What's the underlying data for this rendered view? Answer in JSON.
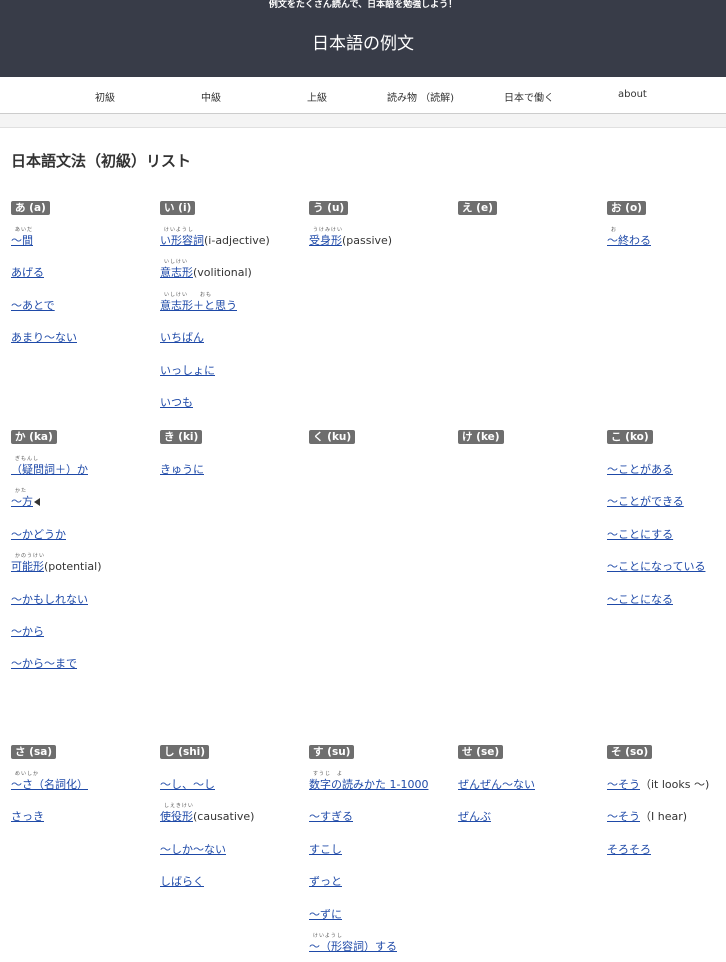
{
  "header": {
    "tagline": "例文をたくさん読んで、日本語を勉強しよう！",
    "site_title": "日本語の例文"
  },
  "nav": [
    "初級",
    "中級",
    "上級",
    "読み物 （読解)",
    "日本で働く",
    "about"
  ],
  "page_title": "日本語文法（初級）リスト",
  "sections": [
    {
      "columns": [
        {
          "badge": "あ (a)",
          "entries": [
            {
              "link": "〜間",
              "ruby": "あいだ"
            },
            {
              "link": "あげる"
            },
            {
              "link": "〜あとで"
            },
            {
              "link": "あまり〜ない"
            }
          ]
        },
        {
          "badge": "い (i)",
          "entries": [
            {
              "link": "い形容詞",
              "suffix": "(i-adjective)",
              "ruby": "けいようし"
            },
            {
              "link": "意志形",
              "suffix": "(volitional)",
              "ruby": "いしけい"
            },
            {
              "link": "意志形＋と思う",
              "ruby": "いしけい　　おも"
            },
            {
              "link": "いちばん"
            },
            {
              "link": "いっしょに"
            },
            {
              "link": "いつも"
            }
          ]
        },
        {
          "badge": "う (u)",
          "entries": [
            {
              "link": "受身形",
              "suffix": "(passive)",
              "ruby": "うけみけい"
            }
          ]
        },
        {
          "badge": "え (e)",
          "entries": []
        },
        {
          "badge": "お (o)",
          "entries": [
            {
              "link": "〜終わる",
              "ruby": "お"
            }
          ]
        }
      ]
    },
    {
      "columns": [
        {
          "badge": "か (ka)",
          "entries": [
            {
              "link": "（疑問詞＋）か",
              "ruby": "ぎもんし"
            },
            {
              "link": "〜方",
              "ruby": "かた",
              "speaker": true
            },
            {
              "link": "〜かどうか"
            },
            {
              "link": "可能形",
              "suffix": "(potential)",
              "ruby": "かのうけい"
            },
            {
              "link": "〜かもしれない"
            },
            {
              "link": "〜から"
            },
            {
              "link": "〜から〜まで"
            }
          ]
        },
        {
          "badge": "き (ki)",
          "entries": [
            {
              "link": "きゅうに"
            }
          ]
        },
        {
          "badge": "く (ku)",
          "entries": []
        },
        {
          "badge": "け (ke)",
          "entries": []
        },
        {
          "badge": "こ (ko)",
          "entries": [
            {
              "link": "〜ことがある"
            },
            {
              "link": "〜ことができる"
            },
            {
              "link": "〜ことにする"
            },
            {
              "link": "〜ことになっている"
            },
            {
              "link": "〜ことになる"
            }
          ]
        }
      ]
    },
    {
      "columns": [
        {
          "badge": "さ (sa)",
          "entries": [
            {
              "link": "〜さ（名詞化）",
              "ruby": "めいしか"
            },
            {
              "link": "さっき"
            }
          ]
        },
        {
          "badge": "し (shi)",
          "entries": [
            {
              "link": "〜し、〜し"
            },
            {
              "link": "使役形",
              "suffix": "(causative)",
              "ruby": "しえきけい"
            },
            {
              "link": "〜しか〜ない"
            },
            {
              "link": "しばらく"
            }
          ]
        },
        {
          "badge": "す (su)",
          "entries": [
            {
              "link": "数字の読みかた 1-1000",
              "ruby": "すうじ　よ"
            },
            {
              "link": "〜すぎる"
            },
            {
              "link": "すこし"
            },
            {
              "link": "ずっと"
            },
            {
              "link": "〜ずに"
            },
            {
              "link": "〜（形容詞）する",
              "ruby": "けいようし"
            }
          ]
        },
        {
          "badge": "せ (se)",
          "entries": [
            {
              "link": "ぜんぜん〜ない"
            },
            {
              "link": "ぜんぶ"
            }
          ]
        },
        {
          "badge": "そ (so)",
          "entries": [
            {
              "link": "〜そう",
              "suffix": "（it looks 〜)"
            },
            {
              "link": "〜そう",
              "suffix": "（I hear)"
            },
            {
              "link": "そろそろ"
            }
          ]
        }
      ]
    }
  ]
}
